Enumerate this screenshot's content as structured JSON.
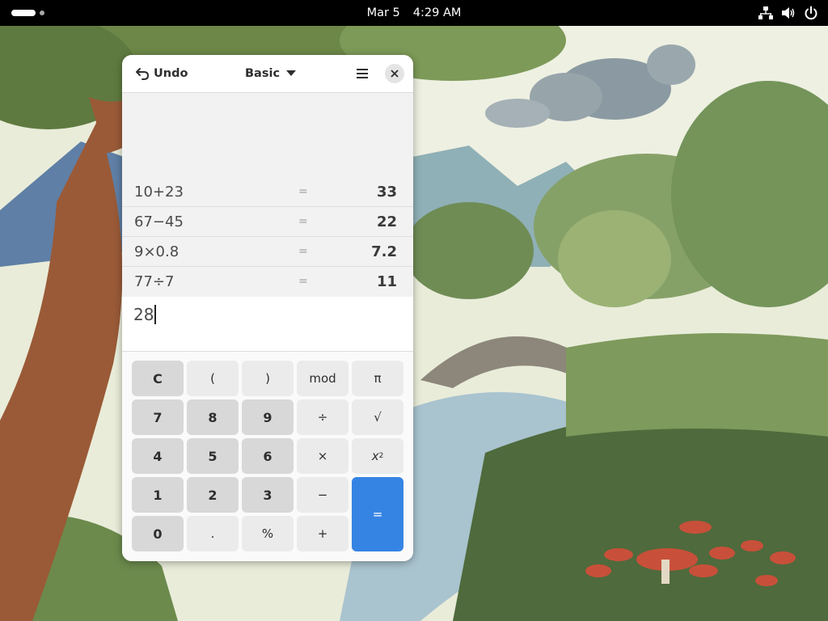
{
  "topbar": {
    "date": "Mar 5",
    "time": "4:29 AM",
    "tray_icons": [
      "network-icon",
      "volume-icon",
      "power-icon"
    ]
  },
  "calculator": {
    "header": {
      "undo_label": "Undo",
      "mode_label": "Basic"
    },
    "history": [
      {
        "expression": "10+23",
        "equals": "=",
        "result": "33"
      },
      {
        "expression": "67−45",
        "equals": "=",
        "result": "22"
      },
      {
        "expression": "9×0.8",
        "equals": "=",
        "result": "7.2"
      },
      {
        "expression": "77÷7",
        "equals": "=",
        "result": "11"
      }
    ],
    "entry_value": "28",
    "keys": {
      "clear": "C",
      "open_paren": "(",
      "close_paren": ")",
      "mod": "mod",
      "pi": "π",
      "seven": "7",
      "eight": "8",
      "nine": "9",
      "divide": "÷",
      "sqrt": "√",
      "four": "4",
      "five": "5",
      "six": "6",
      "multiply": "×",
      "square_base": "x",
      "square_exp": "2",
      "one": "1",
      "two": "2",
      "three": "3",
      "subtract": "−",
      "equals": "=",
      "zero": "0",
      "point": ".",
      "percent": "%",
      "add": "+"
    },
    "colors": {
      "accent": "#3584e4",
      "number_key": "#d8d8d8",
      "operator_key": "#ebebeb"
    }
  }
}
